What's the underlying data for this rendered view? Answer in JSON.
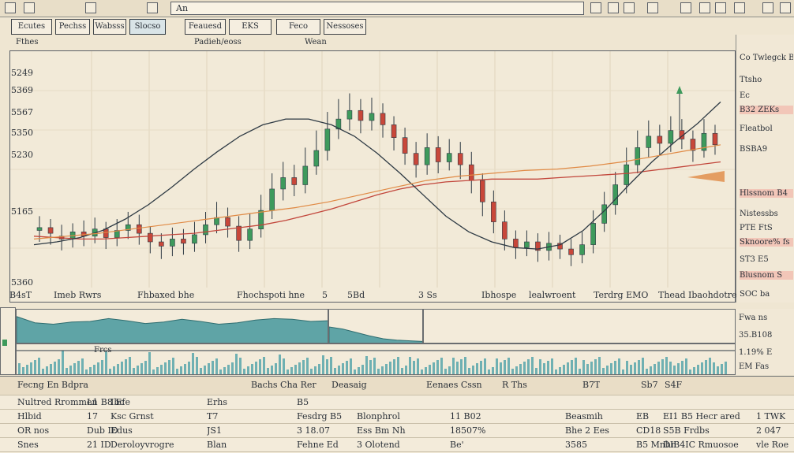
{
  "toolbar": {
    "field_text": "An",
    "icons": [
      "square-icon",
      "grid-icon",
      "bars-icon",
      "window-icon",
      "settings-icon",
      "chart-icon",
      "zoom-icon",
      "save-icon",
      "print-icon",
      "close-icon"
    ]
  },
  "tabs": [
    {
      "label": "Ecutes"
    },
    {
      "label": "Pechss"
    },
    {
      "label": "Wabsss"
    },
    {
      "label": "Slocso"
    },
    {
      "label": "Feauesd"
    },
    {
      "label": "EKS"
    },
    {
      "label": "Feco"
    },
    {
      "label": "Nessoses"
    }
  ],
  "sub_labels": {
    "left": "Fthes",
    "center": "Padieh/eoss",
    "right": "Wean"
  },
  "chart": {
    "y_labels": [
      "5249",
      "5369",
      "5567",
      "5350",
      "5230",
      "5165",
      "5360"
    ],
    "x_labels": [
      "Imeb Rwrs",
      "Fhbaxed bhe",
      "Fhochspoti hne",
      "5",
      "5Bd",
      "3 Ss",
      "Ibhospe",
      "lealwroent",
      "Terdrg EMO",
      "Thead Ibaohdotre"
    ],
    "x_left_label": "B4sT",
    "overlay_label": "Frcs",
    "colors": {
      "up": "#3e9a5c",
      "down": "#c8473a",
      "ma_red": "#c2463b",
      "ma_dark": "#2e3a44",
      "ma_orange": "#e08a45",
      "ma_green": "#6aa882"
    }
  },
  "chart_data": {
    "type": "candlestick",
    "note": "",
    "candles": [
      {
        "o": 520,
        "c": 522,
        "h": 530,
        "l": 512
      },
      {
        "o": 522,
        "c": 518,
        "h": 528,
        "l": 510
      },
      {
        "o": 516,
        "c": 514,
        "h": 524,
        "l": 506
      },
      {
        "o": 514,
        "c": 519,
        "h": 525,
        "l": 508
      },
      {
        "o": 519,
        "c": 516,
        "h": 527,
        "l": 509
      },
      {
        "o": 516,
        "c": 521,
        "h": 529,
        "l": 511
      },
      {
        "o": 521,
        "c": 515,
        "h": 526,
        "l": 507
      },
      {
        "o": 515,
        "c": 520,
        "h": 528,
        "l": 509
      },
      {
        "o": 520,
        "c": 524,
        "h": 533,
        "l": 514
      },
      {
        "o": 524,
        "c": 518,
        "h": 531,
        "l": 510
      },
      {
        "o": 518,
        "c": 512,
        "h": 523,
        "l": 504
      },
      {
        "o": 512,
        "c": 509,
        "h": 518,
        "l": 500
      },
      {
        "o": 509,
        "c": 514,
        "h": 522,
        "l": 502
      },
      {
        "o": 514,
        "c": 511,
        "h": 521,
        "l": 503
      },
      {
        "o": 511,
        "c": 517,
        "h": 526,
        "l": 505
      },
      {
        "o": 517,
        "c": 524,
        "h": 533,
        "l": 511
      },
      {
        "o": 524,
        "c": 529,
        "h": 540,
        "l": 518
      },
      {
        "o": 529,
        "c": 523,
        "h": 536,
        "l": 515
      },
      {
        "o": 523,
        "c": 513,
        "h": 530,
        "l": 505
      },
      {
        "o": 513,
        "c": 521,
        "h": 532,
        "l": 507
      },
      {
        "o": 521,
        "c": 534,
        "h": 545,
        "l": 515
      },
      {
        "o": 534,
        "c": 549,
        "h": 560,
        "l": 528
      },
      {
        "o": 549,
        "c": 557,
        "h": 568,
        "l": 541
      },
      {
        "o": 557,
        "c": 552,
        "h": 566,
        "l": 544
      },
      {
        "o": 552,
        "c": 565,
        "h": 578,
        "l": 546
      },
      {
        "o": 565,
        "c": 576,
        "h": 590,
        "l": 559
      },
      {
        "o": 576,
        "c": 591,
        "h": 603,
        "l": 569
      },
      {
        "o": 591,
        "c": 598,
        "h": 612,
        "l": 584
      },
      {
        "o": 598,
        "c": 604,
        "h": 616,
        "l": 590
      },
      {
        "o": 604,
        "c": 597,
        "h": 612,
        "l": 588
      },
      {
        "o": 597,
        "c": 602,
        "h": 613,
        "l": 590
      },
      {
        "o": 602,
        "c": 594,
        "h": 609,
        "l": 585
      },
      {
        "o": 594,
        "c": 585,
        "h": 600,
        "l": 576
      },
      {
        "o": 585,
        "c": 574,
        "h": 592,
        "l": 566
      },
      {
        "o": 574,
        "c": 566,
        "h": 582,
        "l": 557
      },
      {
        "o": 566,
        "c": 578,
        "h": 588,
        "l": 559
      },
      {
        "o": 578,
        "c": 568,
        "h": 586,
        "l": 560
      },
      {
        "o": 568,
        "c": 574,
        "h": 584,
        "l": 562
      },
      {
        "o": 574,
        "c": 566,
        "h": 582,
        "l": 556
      },
      {
        "o": 566,
        "c": 555,
        "h": 575,
        "l": 546
      },
      {
        "o": 555,
        "c": 540,
        "h": 560,
        "l": 530
      },
      {
        "o": 540,
        "c": 526,
        "h": 548,
        "l": 518
      },
      {
        "o": 526,
        "c": 514,
        "h": 534,
        "l": 506
      },
      {
        "o": 514,
        "c": 508,
        "h": 520,
        "l": 500
      },
      {
        "o": 508,
        "c": 512,
        "h": 520,
        "l": 502
      },
      {
        "o": 512,
        "c": 506,
        "h": 518,
        "l": 498
      },
      {
        "o": 506,
        "c": 511,
        "h": 519,
        "l": 499
      },
      {
        "o": 511,
        "c": 507,
        "h": 517,
        "l": 500
      },
      {
        "o": 507,
        "c": 503,
        "h": 514,
        "l": 495
      },
      {
        "o": 503,
        "c": 510,
        "h": 519,
        "l": 497
      },
      {
        "o": 510,
        "c": 525,
        "h": 534,
        "l": 504
      },
      {
        "o": 525,
        "c": 538,
        "h": 547,
        "l": 519
      },
      {
        "o": 538,
        "c": 552,
        "h": 561,
        "l": 531
      },
      {
        "o": 552,
        "c": 566,
        "h": 578,
        "l": 546
      },
      {
        "o": 566,
        "c": 578,
        "h": 590,
        "l": 560
      },
      {
        "o": 578,
        "c": 586,
        "h": 597,
        "l": 571
      },
      {
        "o": 586,
        "c": 581,
        "h": 594,
        "l": 573
      },
      {
        "o": 581,
        "c": 590,
        "h": 600,
        "l": 575
      },
      {
        "o": 590,
        "c": 584,
        "h": 598,
        "l": 577
      },
      {
        "o": 584,
        "c": 576,
        "h": 590,
        "l": 568
      },
      {
        "o": 576,
        "c": 588,
        "h": 598,
        "l": 571
      },
      {
        "o": 588,
        "c": 580,
        "h": 594,
        "l": 573
      }
    ],
    "ma_red": [
      516,
      515,
      514,
      514,
      515,
      516,
      517,
      518,
      520,
      522,
      524,
      527,
      531,
      535,
      540,
      545,
      549,
      552,
      554,
      555,
      556,
      556,
      556,
      557,
      558,
      559,
      560,
      562,
      564,
      566,
      568
    ],
    "ma_dark": [
      510,
      512,
      515,
      520,
      528,
      538,
      550,
      563,
      575,
      586,
      594,
      598,
      598,
      594,
      586,
      574,
      560,
      545,
      530,
      519,
      512,
      508,
      507,
      510,
      520,
      535,
      552,
      568,
      582,
      595,
      610
    ],
    "ma_orange": [
      514,
      516,
      518,
      521,
      524,
      527,
      530,
      533,
      536,
      540,
      545,
      550,
      555,
      558,
      560,
      562,
      563,
      565,
      568,
      572,
      576,
      580
    ],
    "ylim": [
      480,
      640
    ]
  },
  "right_panel": [
    {
      "text": "Co Twlegck Bezhr"
    },
    {
      "text": "Ttsho"
    },
    {
      "text": "Ec"
    },
    {
      "text": "B32 ZEKs",
      "hl": true
    },
    {
      "text": "Fleatbol"
    },
    {
      "text": "BSBA9"
    },
    {
      "text": "Hlssnom B4",
      "hl": true
    },
    {
      "text": "Nistessbs"
    },
    {
      "text": "PTE FtS"
    },
    {
      "text": "Sknoore% fs",
      "hl": true
    },
    {
      "text": "ST3 E5"
    },
    {
      "text": "Blusnom S",
      "hl": true
    },
    {
      "text": "SOC ba"
    }
  ],
  "lower_right_panel": [
    {
      "text": "Fwa ns"
    },
    {
      "text": "35.B108"
    },
    {
      "text": "1.19% E"
    },
    {
      "text": "EM Fas"
    }
  ],
  "table": {
    "header": [
      "Fecng En Bdpra",
      "Bachs Cha Rer",
      "Deasaig",
      "Eenaes Cssn",
      "R Ths",
      "B7T",
      "Sb7",
      "S4F"
    ],
    "rows": [
      [
        "Nultred Rrommen",
        "L1 B8 Efe",
        "Ibc",
        "Erhs",
        "B5",
        "",
        ""
      ],
      [
        "Hlbid",
        "17",
        "Ksc Grnst",
        "T7",
        "Fesdrg B5",
        "Blonphrol",
        "11 B02",
        "Beasmih",
        "EB",
        "EI1 B5 Hecr ared",
        "1 TWK"
      ],
      [
        "OR nos",
        "Dub ID",
        "Edus",
        "JS1",
        "3 18.07",
        "Ess Bm Nh",
        "18507%",
        "Bhe 2 Ees",
        "CD18",
        "S5B Frdbs",
        "2 047"
      ],
      [
        "Snes",
        "21 ID",
        "Deroloyvrogre",
        "Blan",
        "Fehne Ed",
        "3 Olotend",
        "Be'",
        "3585",
        "B5 Mnhn",
        "DIB4IC Rmuosoe",
        "vle Roe"
      ]
    ]
  }
}
